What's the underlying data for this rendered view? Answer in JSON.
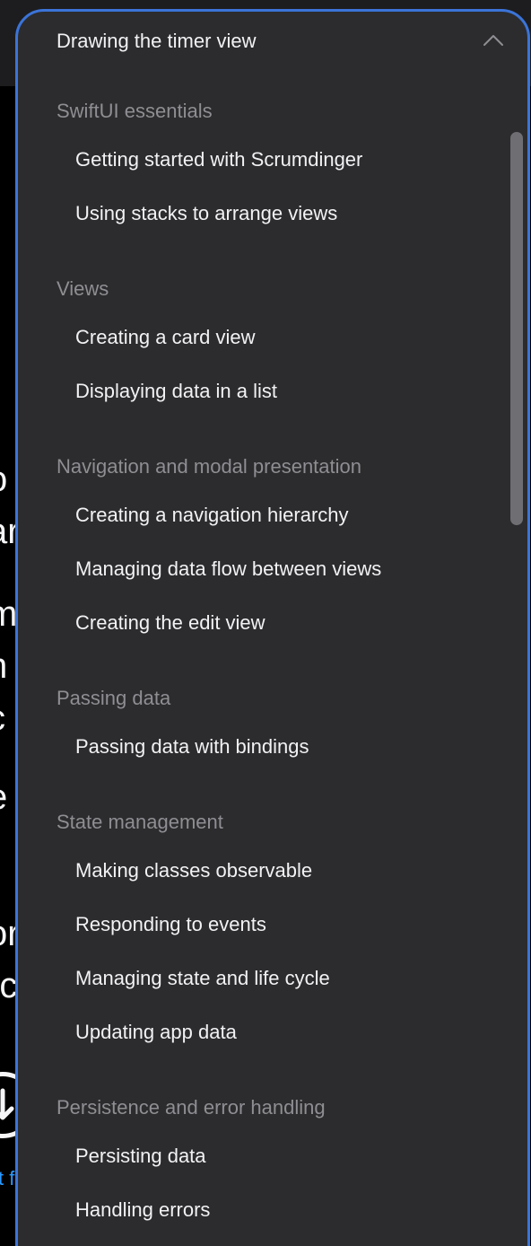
{
  "background": {
    "fragments": [
      "l",
      "o",
      "ar",
      "m",
      "h",
      "c",
      "e",
      "or",
      "rc"
    ],
    "link_fragment": "t f"
  },
  "popover": {
    "title": "Drawing the timer view",
    "sections": [
      {
        "heading": "SwiftUI essentials",
        "items": [
          "Getting started with Scrumdinger",
          "Using stacks to arrange views"
        ]
      },
      {
        "heading": "Views",
        "items": [
          "Creating a card view",
          "Displaying data in a list"
        ]
      },
      {
        "heading": "Navigation and modal presentation",
        "items": [
          "Creating a navigation hierarchy",
          "Managing data flow between views",
          "Creating the edit view"
        ]
      },
      {
        "heading": "Passing data",
        "items": [
          "Passing data with bindings"
        ]
      },
      {
        "heading": "State management",
        "items": [
          "Making classes observable",
          "Responding to events",
          "Managing state and life cycle",
          "Updating app data"
        ]
      },
      {
        "heading": "Persistence and error handling",
        "items": [
          "Persisting data",
          "Handling errors"
        ]
      }
    ]
  },
  "colors": {
    "popover_bg": "#2c2c2e",
    "focus_border": "#3b74d9",
    "heading": "#8e8e93",
    "item": "#f2f2f4",
    "link": "#2997ff"
  },
  "icons": {
    "collapse": "chevron-up-icon",
    "download": "download-icon"
  }
}
